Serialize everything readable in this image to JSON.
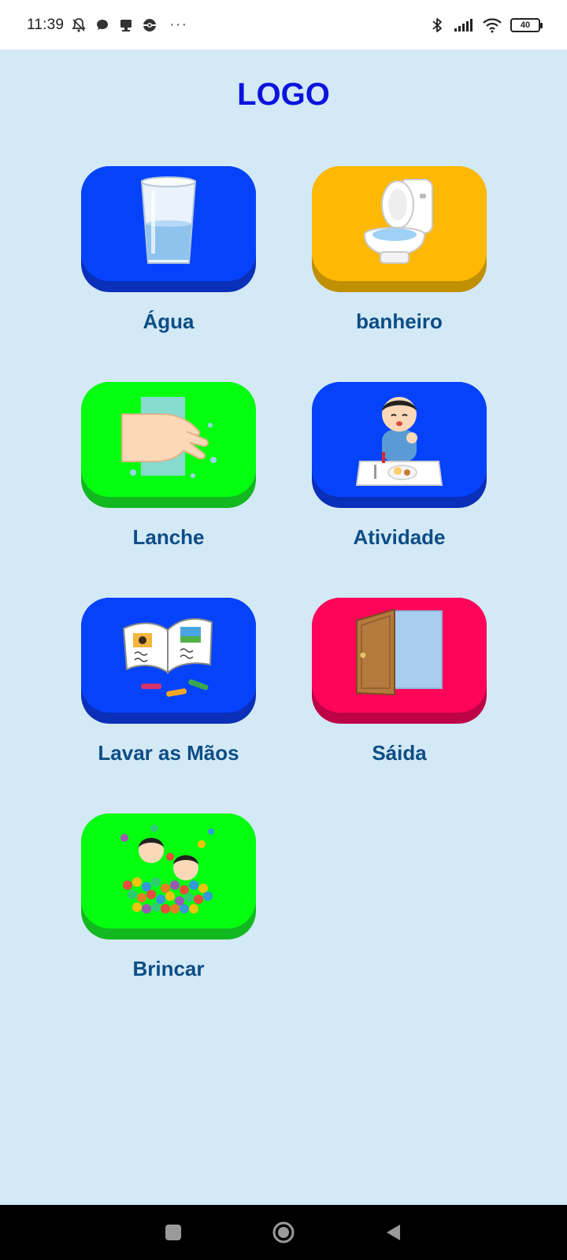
{
  "status_bar": {
    "time": "11:39",
    "left_icons": [
      "bell-off-icon",
      "chat-bubble-icon",
      "monitor-icon",
      "pokeball-icon"
    ],
    "overflow": "···",
    "right_icons": [
      "bluetooth-icon",
      "signal-icon",
      "wifi-icon",
      "battery-icon"
    ],
    "battery_level": "40"
  },
  "header": {
    "logo_text": "LOGO"
  },
  "tiles": [
    {
      "label": "Água",
      "color": "#0443fb",
      "icon": "water-glass-icon"
    },
    {
      "label": "banheiro",
      "color": "#ffb804",
      "icon": "toilet-icon"
    },
    {
      "label": "Lanche",
      "color": "#04ff0f",
      "icon": "washing-hands-icon"
    },
    {
      "label": "Atividade",
      "color": "#0443fb",
      "icon": "child-eating-icon"
    },
    {
      "label": "Lavar as Mãos",
      "color": "#0443fb",
      "icon": "open-book-crayons-icon"
    },
    {
      "label": "Sáida",
      "color": "#ff0459",
      "icon": "open-door-icon"
    },
    {
      "label": "Brincar",
      "color": "#04ff0f",
      "icon": "ball-pit-kids-icon"
    }
  ],
  "nav_bar": {
    "buttons": [
      "recents-button",
      "home-button",
      "back-button"
    ]
  }
}
